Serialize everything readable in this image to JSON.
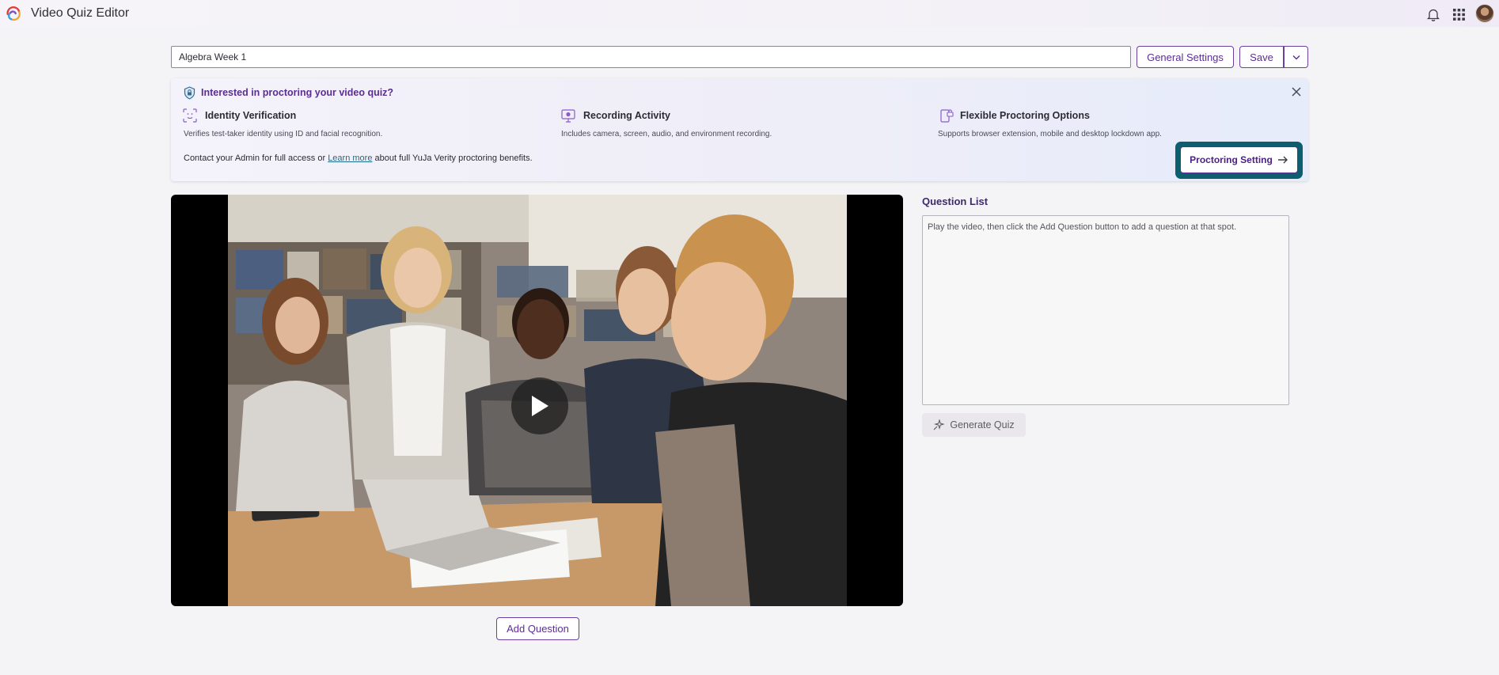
{
  "app": {
    "title": "Video Quiz Editor",
    "icons": [
      "bell-icon",
      "apps-grid-icon",
      "user-avatar"
    ]
  },
  "toolbar": {
    "quiz_title_value": "Algebra Week 1",
    "general_settings_label": "General Settings",
    "save_label": "Save"
  },
  "banner": {
    "heading": "Interested in proctoring your video quiz?",
    "features": [
      {
        "title": "Identity Verification",
        "desc": "Verifies test-taker identity using ID and facial recognition.",
        "icon": "face-scan-icon"
      },
      {
        "title": "Recording Activity",
        "desc": "Includes camera, screen, audio, and environment recording.",
        "icon": "monitor-record-icon"
      },
      {
        "title": "Flexible Proctoring Options",
        "desc": "Supports browser extension, mobile and desktop lockdown app.",
        "icon": "device-lock-icon"
      }
    ],
    "contact_prefix": "Contact your Admin for full access or ",
    "learn_more": "Learn more",
    "contact_suffix": " about full YuJa Verity proctoring benefits.",
    "proctoring_button": "Proctoring Setting"
  },
  "video": {
    "add_question_label": "Add Question"
  },
  "question_list": {
    "title": "Question List",
    "placeholder": "Play the video, then click the Add Question button to add a question at that spot.",
    "generate_label": "Generate Quiz"
  },
  "colors": {
    "accent": "#5b2e91",
    "highlight": "#0d5f70",
    "background": "#f4f3f5"
  }
}
